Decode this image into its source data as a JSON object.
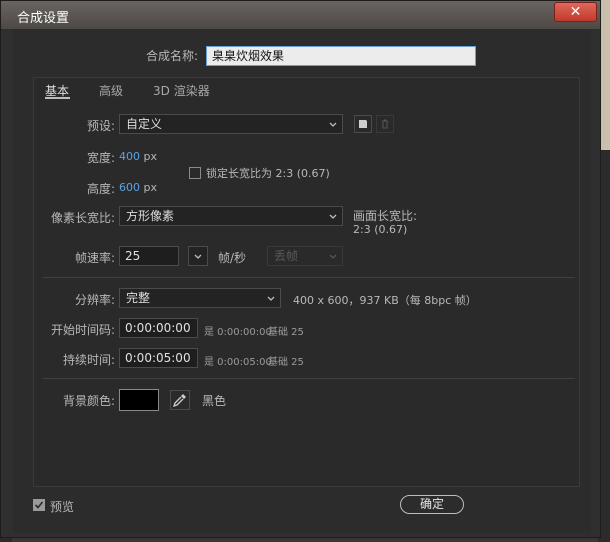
{
  "window": {
    "title": "合成设置",
    "close_glyph": "✕"
  },
  "comp_name": {
    "label": "合成名称:",
    "value": "臬臬炊烟效果"
  },
  "tabs": [
    {
      "label": "基本",
      "active": true
    },
    {
      "label": "高级",
      "active": false
    },
    {
      "label": "3D 渲染器",
      "active": false
    }
  ],
  "preset": {
    "label": "预设:",
    "value": "自定义"
  },
  "width": {
    "label": "宽度:",
    "value": "400",
    "unit": "px"
  },
  "height": {
    "label": "高度:",
    "value": "600",
    "unit": "px"
  },
  "lock_aspect": {
    "label": "锁定长宽比为 2:3 (0.67)",
    "checked": false
  },
  "pixel_aspect": {
    "label": "像素长宽比:",
    "value": "方形像素"
  },
  "frame_aspect": {
    "label": "画面长宽比:",
    "value": "2:3 (0.67)"
  },
  "frame_rate": {
    "label": "帧速率:",
    "value": "25",
    "unit": "帧/秒",
    "drop_frame": "丢帧"
  },
  "resolution": {
    "label": "分辨率:",
    "value": "完整",
    "info": "400 x 600，937 KB（每 8bpc 帧）"
  },
  "start_timecode": {
    "label": "开始时间码:",
    "value": "0:00:00:00",
    "note": "是 0:00:00:00",
    "base": "基础 25"
  },
  "duration": {
    "label": "持续时间:",
    "value": "0:00:05:00",
    "note": "是 0:00:05:00",
    "base": "基础 25"
  },
  "background": {
    "label": "背景颜色:",
    "color": "#000000",
    "color_name": "黑色"
  },
  "preview": {
    "label": "预览",
    "checked": true
  },
  "ok_button": {
    "label": "确定"
  }
}
